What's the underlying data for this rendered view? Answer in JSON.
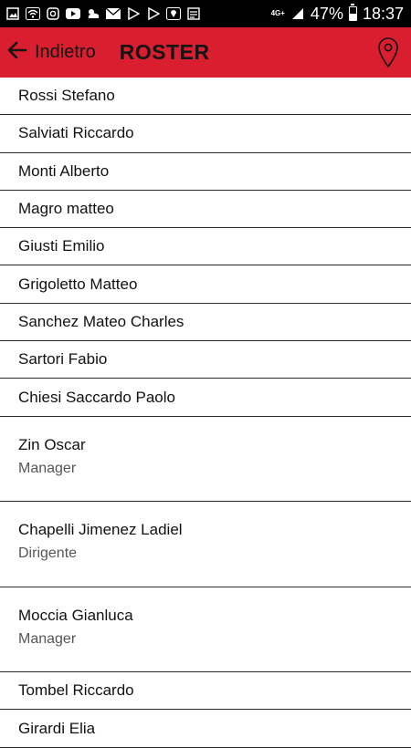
{
  "status_bar": {
    "icons": [
      "image-icon",
      "wifi-icon",
      "instagram-icon",
      "youtube-icon",
      "weather-icon",
      "mail-icon",
      "play-store-icon",
      "play-store-icon",
      "location-update-icon",
      "mms-icon"
    ],
    "network": "4G+",
    "battery_percent": "47%",
    "battery_level": 0.47,
    "time": "18:37"
  },
  "toolbar": {
    "back_label": "Indietro",
    "title": "ROSTER",
    "background_color": "#d81e2f",
    "map_icon": "map-pin-icon"
  },
  "roster": [
    {
      "name": "Rossi Stefano"
    },
    {
      "name": "Salviati Riccardo"
    },
    {
      "name": "Monti Alberto"
    },
    {
      "name": "Magro matteo"
    },
    {
      "name": "Giusti Emilio"
    },
    {
      "name": "Grigoletto Matteo"
    },
    {
      "name": "Sanchez Mateo Charles"
    },
    {
      "name": "Sartori Fabio"
    },
    {
      "name": "Chiesi Saccardo Paolo"
    },
    {
      "name": "Zin Oscar",
      "role": "Manager"
    },
    {
      "name": "Chapelli Jimenez Ladiel",
      "role": "Dirigente"
    },
    {
      "name": "Moccia Gianluca",
      "role": "Manager"
    },
    {
      "name": "Tombel Riccardo"
    },
    {
      "name": "Girardi Elia"
    }
  ]
}
